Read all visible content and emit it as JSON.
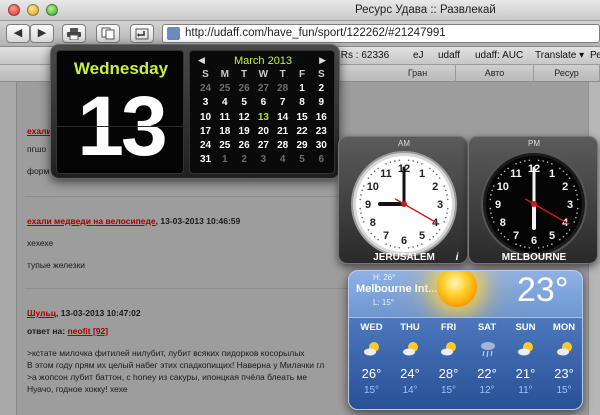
{
  "window": {
    "title": "Ресурс Удава :: Развлекай"
  },
  "toolbar": {
    "url": "http://udaff.com/have_fun/sport/122262/#21247991",
    "back_label": "◀",
    "forward_label": "▶"
  },
  "bookmarks": {
    "items": [
      {
        "label": "IRs : 62336"
      },
      {
        "label": "eJ"
      },
      {
        "label": "udaff"
      },
      {
        "label": "udaff: AUC"
      },
      {
        "label": "Translate ▾"
      },
      {
        "label": "Ресурс"
      }
    ]
  },
  "tabs": {
    "items": [
      {
        "label": "С"
      },
      {
        "label": "Гран"
      },
      {
        "label": "Авто"
      },
      {
        "label": "Ресур"
      }
    ]
  },
  "page": {
    "post1": {
      "author": "ехали",
      "text1": "пгшо",
      "text2": "форм"
    },
    "post2": {
      "author": "ехали медведи на велосипеде",
      "date": ", 13-03-2013 10:46:59",
      "line1": "хехехе",
      "line2": "тупые железки"
    },
    "post3": {
      "author": "Шульц",
      "date": ", 13-03-2013 10:47:02",
      "reply_prefix": "ответ на:",
      "reply_link": "neofit [92]",
      "line1": ">кстате милочка фитилей нилубит, лубит всяких пидорков косорылых",
      "line2": "В этом году прям их целый набег этих спадкопищих! Наверна у Милачки гл",
      "line3": ">а жопсон лубит баттон,  с honey из сакуры, ипонцкая пчёла блеать ме",
      "line4": "Нуачо, годное хокку! хехе"
    }
  },
  "calendar": {
    "weekday": "Wednesday",
    "day": "13",
    "month_title": "March 2013",
    "headers": [
      "S",
      "M",
      "T",
      "W",
      "T",
      "F",
      "S"
    ],
    "weeks": [
      [
        "24",
        "25",
        "26",
        "27",
        "28",
        "1",
        "2"
      ],
      [
        "3",
        "4",
        "5",
        "6",
        "7",
        "8",
        "9"
      ],
      [
        "10",
        "11",
        "12",
        "13",
        "14",
        "15",
        "16"
      ],
      [
        "17",
        "18",
        "19",
        "20",
        "21",
        "22",
        "23"
      ],
      [
        "24",
        "25",
        "26",
        "27",
        "28",
        "29",
        "30"
      ],
      [
        "31",
        "1",
        "2",
        "3",
        "4",
        "5",
        "6"
      ]
    ],
    "accent_color": "#c8f03a"
  },
  "clocks": [
    {
      "city": "JERUSALEM",
      "period": "AM",
      "hour": 9,
      "minute": 0,
      "second": 20,
      "face": "light"
    },
    {
      "city": "MELBOURNE",
      "period": "PM",
      "hour": 6,
      "minute": 0,
      "second": 20,
      "face": "dark"
    }
  ],
  "weather": {
    "location": "Melbourne Int...",
    "high": "H: 26°",
    "low": "L: 15°",
    "current_temp": "23°",
    "info_label": "i",
    "forecast": [
      {
        "day": "WED",
        "hi": "26°",
        "lo": "15°",
        "icon": "sun-cloud-icon"
      },
      {
        "day": "THU",
        "hi": "24°",
        "lo": "14°",
        "icon": "sun-cloud-icon"
      },
      {
        "day": "FRI",
        "hi": "28°",
        "lo": "15°",
        "icon": "sun-cloud-icon"
      },
      {
        "day": "SAT",
        "hi": "22°",
        "lo": "12°",
        "icon": "rain-icon"
      },
      {
        "day": "SUN",
        "hi": "21°",
        "lo": "11°",
        "icon": "sun-cloud-icon"
      },
      {
        "day": "MON",
        "hi": "23°",
        "lo": "15°",
        "icon": "sun-cloud-icon"
      }
    ]
  }
}
